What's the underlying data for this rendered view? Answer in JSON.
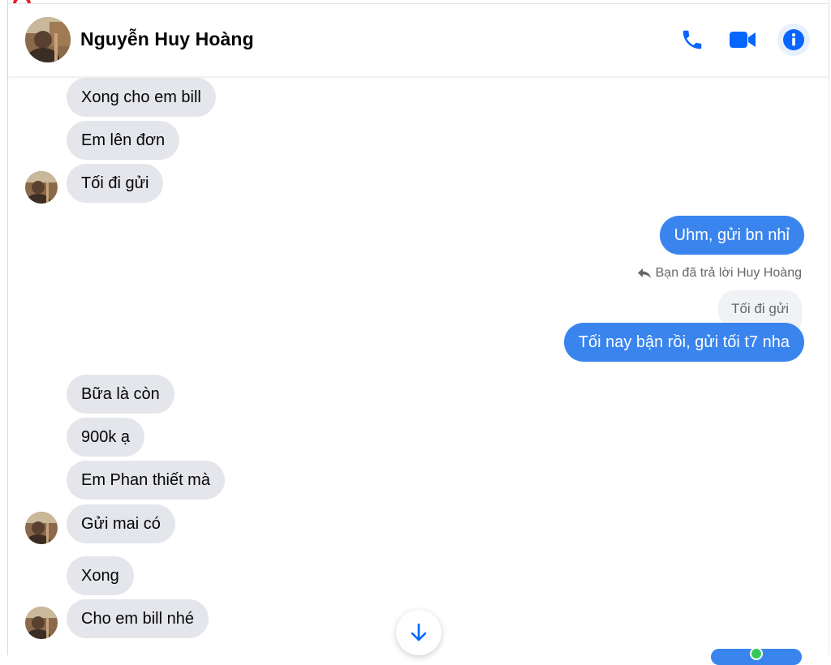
{
  "header": {
    "contact_name": "Nguyễn Huy Hoàng",
    "icons": [
      "phone-icon",
      "video-camera-icon",
      "info-icon"
    ],
    "accent_color": "#0866ff"
  },
  "messages": [
    {
      "id": "m1",
      "side": "in",
      "text": "Xong cho em bill"
    },
    {
      "id": "m2",
      "side": "in",
      "text": "Em lên đơn"
    },
    {
      "id": "m3",
      "side": "in",
      "text": "Tối đi gửi"
    },
    {
      "id": "m4",
      "side": "out",
      "text": "Uhm, gửi bn nhỉ"
    },
    {
      "id": "m5",
      "side": "out",
      "text": "Tối nay bận rồi, gửi tối t7 nha"
    },
    {
      "id": "m6",
      "side": "in",
      "text": "Bữa là còn"
    },
    {
      "id": "m7",
      "side": "in",
      "text": "900k ạ"
    },
    {
      "id": "m8",
      "side": "in",
      "text": "Em Phan thiết mà"
    },
    {
      "id": "m9",
      "side": "in",
      "text": "Gửi mai có"
    },
    {
      "id": "m10",
      "side": "in",
      "text": "Xong"
    },
    {
      "id": "m11",
      "side": "in",
      "text": "Cho em bill nhé"
    }
  ],
  "reply": {
    "note": "Bạn đã trả lời Huy Hoàng",
    "quoted_text": "Tối đi gửi"
  },
  "colors": {
    "incoming_bubble": "#e4e6eb",
    "outgoing_bubble": "#3a84ee",
    "recording_indicator": "#e41e26"
  }
}
